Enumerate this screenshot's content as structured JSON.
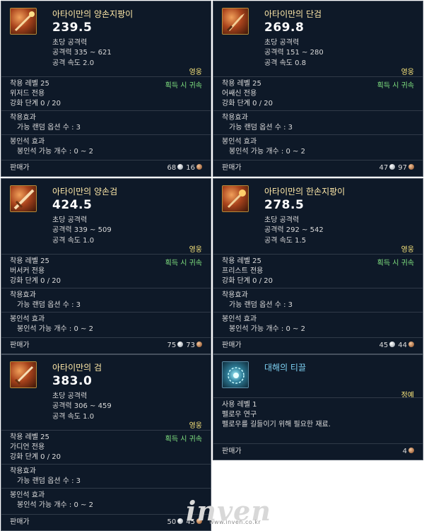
{
  "cards": [
    {
      "icon": "staff-weapon-icon",
      "name": "아타이만의 양손지팡이",
      "dps": "239.5",
      "dps_label": "초당 공격력",
      "attack": "공격력 335 ~ 621",
      "speed": "공격 속도 2.0",
      "grade": "영웅",
      "req_level": "착용 레벨 25",
      "bind": "획득 시 귀속",
      "job": "위저드 전용",
      "enhance": "강화 단계 0 / 20",
      "equip_title": "착용효과",
      "equip_desc": "가능 랜덤 옵션 수 : 3",
      "seal_title": "봉인석 효과",
      "seal_desc": "봉인석 가능 개수 : 0 ~ 2",
      "sell_label": "판매가",
      "silver": "68",
      "copper": "16"
    },
    {
      "icon": "dagger-weapon-icon",
      "name": "아타이만의 단검",
      "dps": "269.8",
      "dps_label": "초당 공격력",
      "attack": "공격력 151 ~ 280",
      "speed": "공격 속도 0.8",
      "grade": "영웅",
      "req_level": "착용 레벨 25",
      "bind": "획득 시 귀속",
      "job": "어쌔신 전용",
      "enhance": "강화 단계 0 / 20",
      "equip_title": "착용효과",
      "equip_desc": "가능 랜덤 옵션 수 : 3",
      "seal_title": "봉인석 효과",
      "seal_desc": "봉인석 가능 개수 : 0 ~ 2",
      "sell_label": "판매가",
      "silver": "47",
      "copper": "97"
    },
    {
      "icon": "two-handed-sword-icon",
      "name": "아타이만의 양손검",
      "dps": "424.5",
      "dps_label": "초당 공격력",
      "attack": "공격력 339 ~ 509",
      "speed": "공격 속도 1.0",
      "grade": "영웅",
      "req_level": "착용 레벨 25",
      "bind": "획득 시 귀속",
      "job": "버서커 전용",
      "enhance": "강화 단계 0 / 20",
      "equip_title": "착용효과",
      "equip_desc": "가능 랜덤 옵션 수 : 3",
      "seal_title": "봉인석 효과",
      "seal_desc": "봉인석 가능 개수 : 0 ~ 2",
      "sell_label": "판매가",
      "silver": "75",
      "copper": "73"
    },
    {
      "icon": "wand-weapon-icon",
      "name": "아타이만의 한손지팡이",
      "dps": "278.5",
      "dps_label": "초당 공격력",
      "attack": "공격력 292 ~ 542",
      "speed": "공격 속도 1.5",
      "grade": "영웅",
      "req_level": "착용 레벨 25",
      "bind": "획득 시 귀속",
      "job": "프리스트 전용",
      "enhance": "강화 단계 0 / 20",
      "equip_title": "착용효과",
      "equip_desc": "가능 랜덤 옵션 수 : 3",
      "seal_title": "봉인석 효과",
      "seal_desc": "봉인석 가능 개수 : 0 ~ 2",
      "sell_label": "판매가",
      "silver": "45",
      "copper": "44"
    },
    {
      "icon": "sword-weapon-icon",
      "name": "아타이만의 검",
      "dps": "383.0",
      "dps_label": "초당 공격력",
      "attack": "공격력 306 ~ 459",
      "speed": "공격 속도 1.0",
      "grade": "영웅",
      "req_level": "착용 레벨 25",
      "bind": "획득 시 귀속",
      "job": "가디언 전용",
      "enhance": "강화 단계 0 / 20",
      "equip_title": "착용효과",
      "equip_desc": "가능 랜덤 옵션 수 : 3",
      "seal_title": "봉인석 효과",
      "seal_desc": "봉인석 가능 개수 : 0 ~ 2",
      "sell_label": "판매가",
      "silver": "50",
      "copper": "45"
    }
  ],
  "material": {
    "icon": "energy-orb-icon",
    "name": "대해의 티끌",
    "grade": "정예",
    "use_level": "사용 레벨 1",
    "job": "펠로우 연구",
    "desc": "펠로우를 길들이기 위해 필요한 재료.",
    "sell_label": "판매가",
    "price": "4"
  },
  "watermark": {
    "logo": "inven",
    "url": "www.inven.co.kr"
  },
  "colors": {
    "panel_bg": "#0e1928",
    "item_name": "#ffe9a8",
    "material_name": "#7ed3f5",
    "grade": "#f6e27a",
    "bind": "#7fe07f",
    "section_title": "#f7d28a",
    "option_text": "#6fdc6f"
  }
}
